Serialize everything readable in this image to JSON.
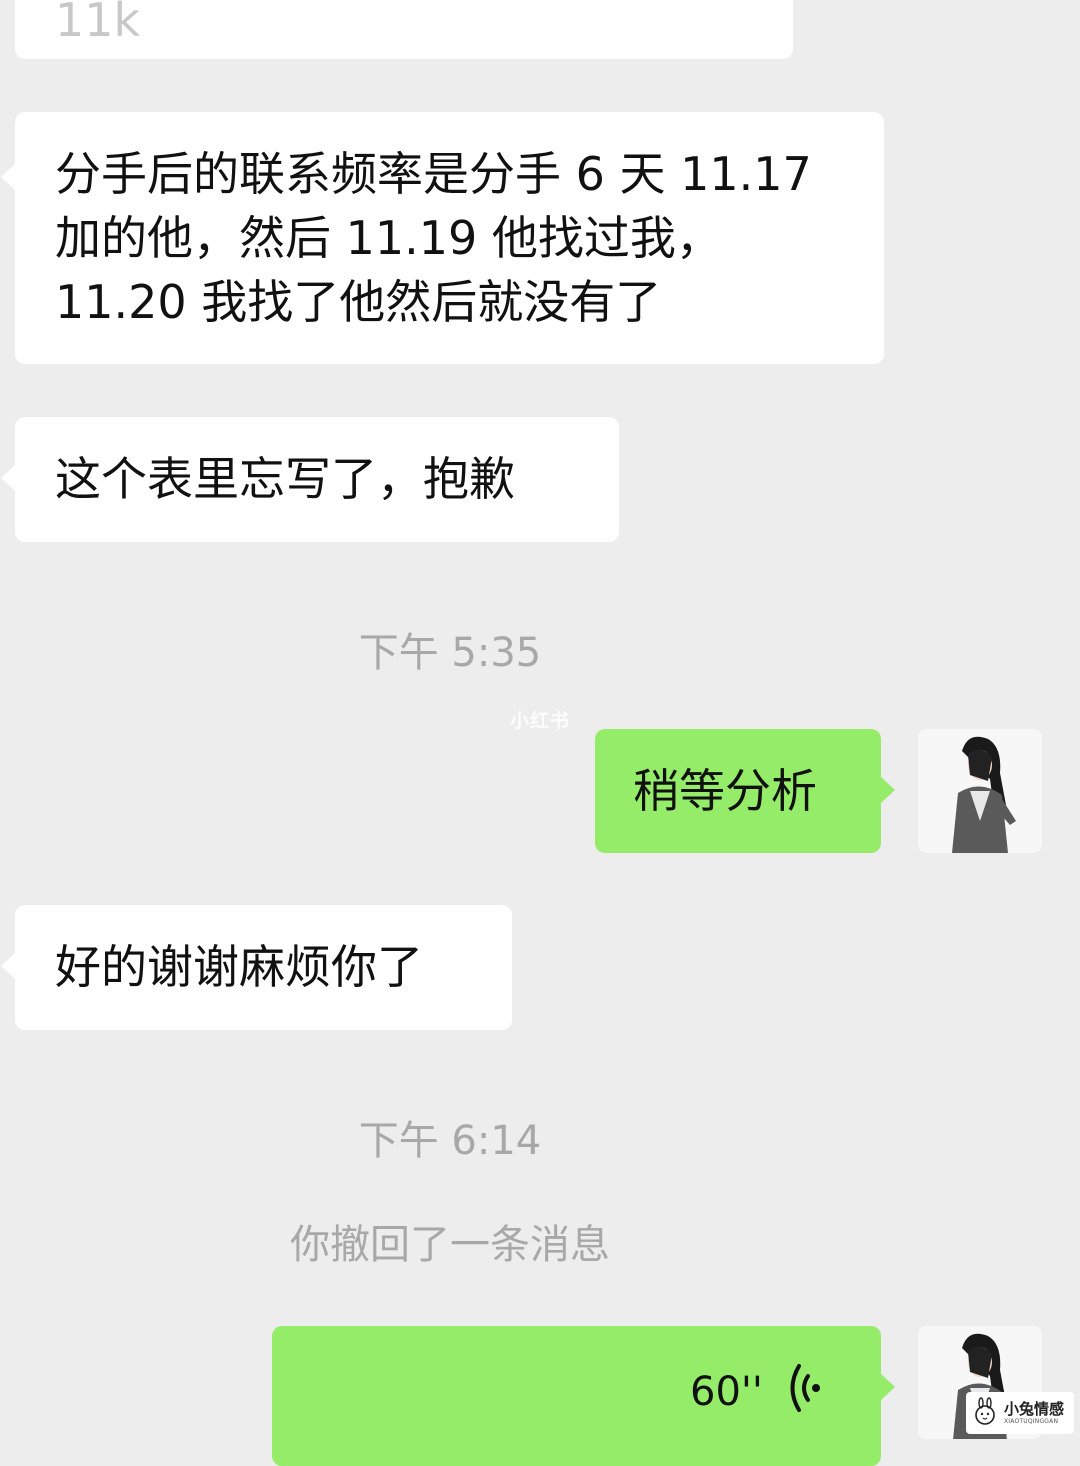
{
  "messages": [
    {
      "sender": "contact",
      "lines": [
        "11k"
      ]
    },
    {
      "sender": "contact",
      "lines": [
        "分手后的联系频率是分手 6 天 11.17",
        "加的他，然后 11.19 他找过我，",
        "11.20 我找了他然后就没有了"
      ]
    },
    {
      "sender": "contact",
      "lines": [
        "这个表里忘写了，抱歉"
      ]
    },
    {
      "type": "timestamp",
      "text": "下午 5:35"
    },
    {
      "sender": "me",
      "lines": [
        "稍等分析"
      ]
    },
    {
      "sender": "contact",
      "lines": [
        "好的谢谢麻烦你了"
      ]
    },
    {
      "type": "timestamp",
      "text": "下午 6:14"
    },
    {
      "type": "notice",
      "text": "你撤回了一条消息"
    },
    {
      "sender": "me",
      "type": "voice",
      "duration": "60''"
    }
  ],
  "watermark": "小红书",
  "brand": {
    "name": "小兔情感",
    "sub": "XIAOTUQINGGAN"
  },
  "colors": {
    "background": "#ededed",
    "incoming_bubble": "#ffffff",
    "outgoing_bubble": "#95ec69",
    "system_text": "#a8a8a8"
  },
  "icons": {
    "voice": "voice-wave-icon",
    "avatar": "avatar-photo"
  }
}
